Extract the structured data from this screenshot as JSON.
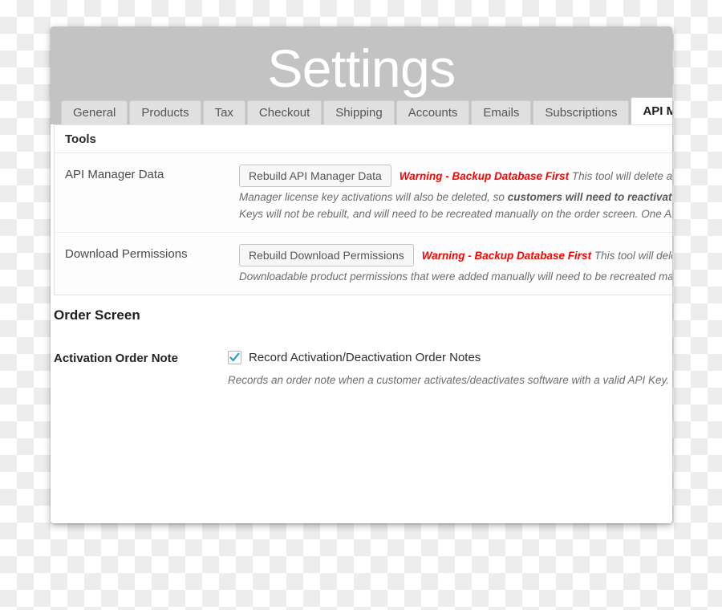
{
  "window": {
    "title": "Settings"
  },
  "tabs": [
    {
      "label": "General",
      "active": false
    },
    {
      "label": "Products",
      "active": false
    },
    {
      "label": "Tax",
      "active": false
    },
    {
      "label": "Checkout",
      "active": false
    },
    {
      "label": "Shipping",
      "active": false
    },
    {
      "label": "Accounts",
      "active": false
    },
    {
      "label": "Emails",
      "active": false
    },
    {
      "label": "Subscriptions",
      "active": false
    },
    {
      "label": "API Manager",
      "active": true
    }
  ],
  "tools": {
    "heading": "Tools",
    "rows": [
      {
        "label": "API Manager Data",
        "button_label": "Rebuild API Manager Data",
        "warning": "Warning - Backup Database First",
        "desc_inline": " This tool will delete and rebuild a",
        "desc_line2_a": "Manager license key activations will also be deleted, so ",
        "desc_line2_b": "customers will need to reactivate software ",
        "desc_line3": "Keys will not be rebuilt, and will need to be recreated manually on the order screen. One API Key will b"
      },
      {
        "label": "Download Permissions",
        "button_label": "Rebuild Download Permissions",
        "warning": "Warning - Backup Database First",
        "desc_inline": " This tool will delete and rebu",
        "desc_line2": "Downloadable product permissions that were added manually will need to be recreated manually on"
      }
    ]
  },
  "order_screen": {
    "heading": "Order Screen",
    "activation_note": {
      "label": "Activation Order Note",
      "checkbox_label": "Record Activation/Deactivation Order Notes",
      "checked": true,
      "description": "Records an order note when a customer activates/deactivates software with a valid API Key."
    }
  },
  "colors": {
    "header_band": "#c3c3c3",
    "warning_red": "#ff0000",
    "checkbox_check": "#1e9fd8",
    "active_tab_bg": "#ffffff",
    "tab_bg": "#e0e0e0"
  }
}
